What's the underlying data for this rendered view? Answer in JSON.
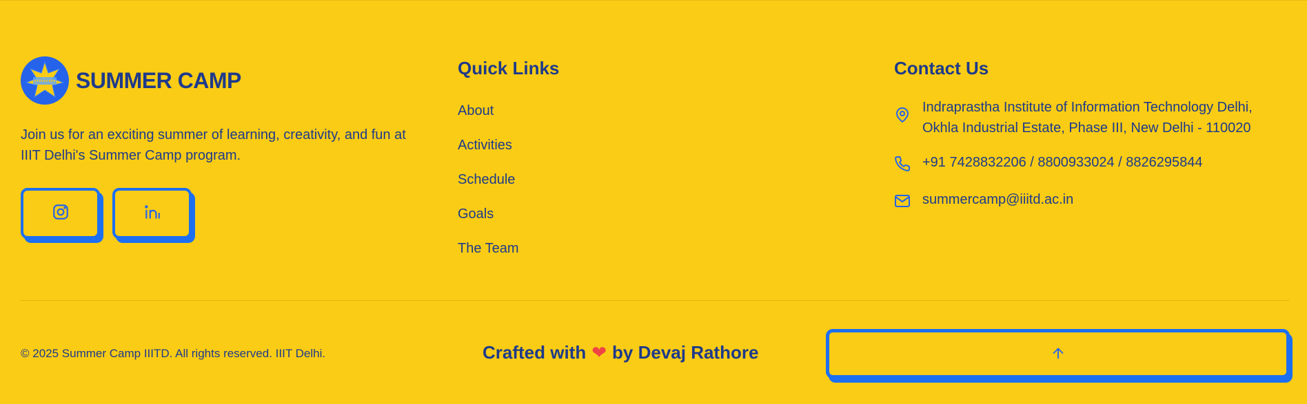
{
  "brand": {
    "name": "SUMMER CAMP",
    "logo_icon": "summer-camp-star-badge",
    "description": "Join us for an exciting summer of learning, creativity, and fun at IIIT Delhi's Summer Camp program."
  },
  "socials": [
    {
      "icon": "instagram-icon"
    },
    {
      "icon": "linkedin-icon"
    }
  ],
  "quick_links": {
    "title": "Quick Links",
    "items": [
      "About",
      "Activities",
      "Schedule",
      "Goals",
      "The Team"
    ]
  },
  "contact": {
    "title": "Contact Us",
    "address_line1": "Indraprastha Institute of Information Technology Delhi,",
    "address_line2": "Okhla Industrial Estate, Phase III, New Delhi - 110020",
    "phone": "+91 7428832206 / 8800933024 / 8826295844",
    "email": "summercamp@iiitd.ac.in"
  },
  "bottom": {
    "copyright": "© 2025 Summer Camp IIITD. All rights reserved. IIIT Delhi.",
    "crafted_prefix": "Crafted with",
    "crafted_heart": "❤",
    "crafted_suffix": "by Devaj Rathore",
    "back_to_top_icon": "arrow-up-icon"
  },
  "colors": {
    "background": "#FACC15",
    "text": "#1E3A8A",
    "accent": "#1D6FF2",
    "heart": "#EF4444"
  }
}
